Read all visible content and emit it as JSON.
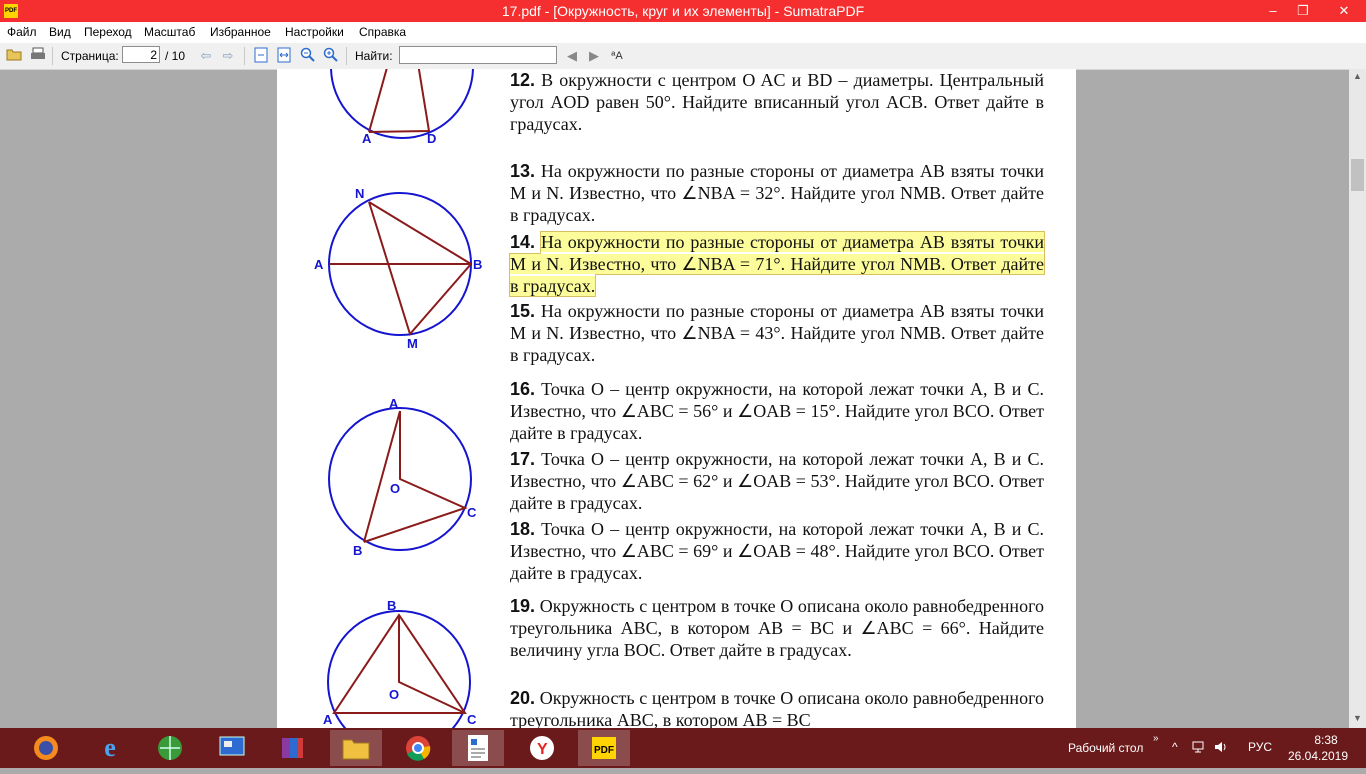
{
  "window": {
    "title": "17.pdf - [Окружность, круг и их элементы] - SumatraPDF",
    "app_icon_text": "PDF",
    "minimize": "–",
    "restore": "❐",
    "close": "✕"
  },
  "menu": [
    "Файл",
    "Вид",
    "Переход",
    "Масштаб",
    "Избранное",
    "Настройки",
    "Справка"
  ],
  "toolbar": {
    "page_label": "Страница:",
    "page_value": "2",
    "page_total": "/ 10",
    "find_label": "Найти:",
    "find_value": ""
  },
  "colors": {
    "title_bar": "#f52f2f",
    "circle": "#1515d0",
    "lines": "#8b1a1a",
    "highlight": "#fcfc9a",
    "taskbar": "#6a1a1a"
  },
  "figures": {
    "f1": {
      "A": "A",
      "D": "D"
    },
    "f2": {
      "N": "N",
      "A": "A",
      "B": "B",
      "M": "M"
    },
    "f3": {
      "A": "A",
      "O": "O",
      "C": "C",
      "B": "B"
    },
    "f4": {
      "B": "B",
      "O": "O",
      "A": "A",
      "C": "C"
    }
  },
  "problems": [
    {
      "num": "12.",
      "text": "В окружности с центром O AC и BD – диаметры. Центральный угол AOD равен 50°. Найдите вписанный угол ACB. Ответ дайте в градусах."
    },
    {
      "num": "13.",
      "text": "На окружности по разные стороны от диаметра AB взяты точки M и N. Известно, что ∠NBA = 32°. Найдите угол NMB. Ответ дайте в градусах."
    },
    {
      "num": "14.",
      "text": "На окружности по разные стороны от диаметра AB взяты точки M и N. Известно, что ∠NBA = 71°. Найдите угол NMB. Ответ дайте в градусах."
    },
    {
      "num": "15.",
      "text": "На окружности по разные стороны от диаметра AB взяты точки M и N. Известно, что ∠NBA = 43°. Найдите угол NMB. Ответ дайте в градусах."
    },
    {
      "num": "16.",
      "text": "Точка O – центр окружности, на которой лежат точки A, B и C. Известно, что ∠ABC = 56° и ∠OAB = 15°. Найдите угол BCO. Ответ дайте в градусах."
    },
    {
      "num": "17.",
      "text": "Точка O – центр окружности, на которой лежат точки A, B и C. Известно, что ∠ABC = 62° и ∠OAB = 53°. Найдите угол BCO. Ответ дайте в градусах."
    },
    {
      "num": "18.",
      "text": "Точка O – центр окружности, на которой лежат точки A, B и C. Известно, что ∠ABC = 69° и ∠OAB = 48°. Найдите угол BCO. Ответ дайте в градусах."
    },
    {
      "num": "19.",
      "text": "Окружность с центром в точке O описана около равнобедренного треугольника ABC, в котором AB = BC и ∠ABC = 66°. Найдите величину угла BOC. Ответ дайте в градусах."
    },
    {
      "num": "20.",
      "text": "Окружность с центром в точке O описана около равнобедренного треугольника ABC, в котором AB = BC"
    }
  ],
  "taskbar": {
    "apps": [
      "firefox",
      "internet-explorer",
      "network",
      "control-panel",
      "winrar",
      "file-explorer",
      "chrome",
      "document-viewer",
      "yandex-browser",
      "sumatra-pdf"
    ],
    "desktop_label": "Рабочий стол",
    "language": "РУС",
    "time": "8:38",
    "date": "26.04.2019"
  }
}
